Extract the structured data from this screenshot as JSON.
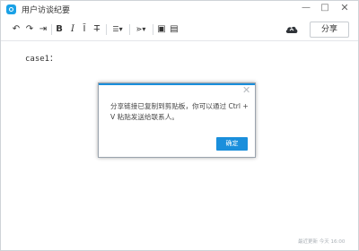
{
  "window": {
    "title": "用户访谈纪要",
    "min_glyph": "—",
    "max_glyph": "□",
    "close_glyph": "✕"
  },
  "toolbar": {
    "undo_glyph": "↶",
    "redo_glyph": "↷",
    "export_glyph": "⇥",
    "bold_glyph": "B",
    "italic_glyph": "I",
    "clear_format_glyph": "Ī",
    "strike_glyph": "T̶",
    "list_glyph": "☰▾",
    "insert_glyph": "⋗▾",
    "image_glyph": "▣",
    "table_glyph": "▤",
    "share_label": "分享"
  },
  "document": {
    "content": "case1："
  },
  "dialog": {
    "line1": "分享链接已复制到剪贴板，你可以通过 Ctrl +",
    "line2": "V 粘贴发送给联系人。",
    "close_glyph": "✕",
    "ok_label": "确定"
  },
  "footer": {
    "status": "最近更新 今天 16:00"
  },
  "colors": {
    "accent": "#1a8fdc",
    "app_icon": "#1aa1e6"
  }
}
